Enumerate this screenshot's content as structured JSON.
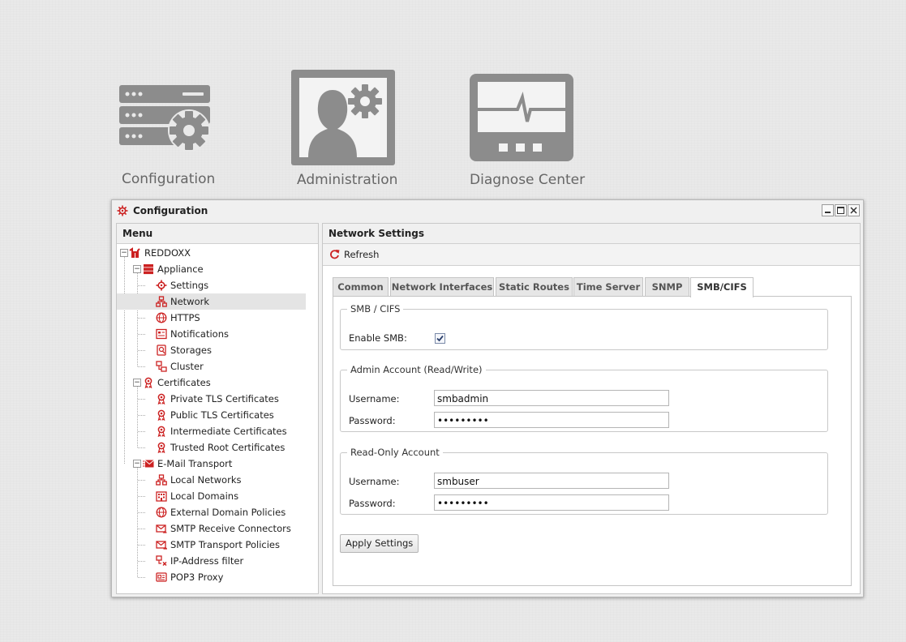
{
  "desktop": {
    "icons": [
      {
        "label": "Configuration"
      },
      {
        "label": "Administration"
      },
      {
        "label": "Diagnose Center"
      }
    ]
  },
  "window": {
    "title": "Configuration"
  },
  "menu": {
    "header": "Menu",
    "tree": [
      {
        "label": "REDDOXX",
        "icon": "reddoxx-logo-icon"
      },
      {
        "label": "Appliance",
        "icon": "appliance-icon"
      },
      {
        "label": "Settings",
        "icon": "gear-icon"
      },
      {
        "label": "Network",
        "icon": "network-icon",
        "selected": true
      },
      {
        "label": "HTTPS",
        "icon": "globe-icon"
      },
      {
        "label": "Notifications",
        "icon": "notification-icon"
      },
      {
        "label": "Storages",
        "icon": "storage-icon"
      },
      {
        "label": "Cluster",
        "icon": "cluster-icon"
      },
      {
        "label": "Certificates",
        "icon": "certificate-icon"
      },
      {
        "label": "Private TLS Certificates",
        "icon": "certificate-icon"
      },
      {
        "label": "Public TLS Certificates",
        "icon": "certificate-icon"
      },
      {
        "label": "Intermediate Certificates",
        "icon": "certificate-icon"
      },
      {
        "label": "Trusted Root Certificates",
        "icon": "certificate-icon"
      },
      {
        "label": "E-Mail Transport",
        "icon": "email-transport-icon"
      },
      {
        "label": "Local Networks",
        "icon": "network-icon"
      },
      {
        "label": "Local Domains",
        "icon": "building-icon"
      },
      {
        "label": "External Domain Policies",
        "icon": "globe-icon"
      },
      {
        "label": "SMTP Receive Connectors",
        "icon": "mail-receive-icon"
      },
      {
        "label": "SMTP Transport Policies",
        "icon": "mail-send-icon"
      },
      {
        "label": "IP-Address filter",
        "icon": "ip-filter-icon"
      },
      {
        "label": "POP3 Proxy",
        "icon": "pop3-icon"
      }
    ]
  },
  "settings": {
    "header": "Network Settings",
    "refresh_label": "Refresh",
    "tabs": [
      {
        "label": "Common"
      },
      {
        "label": "Network Interfaces"
      },
      {
        "label": "Static Routes"
      },
      {
        "label": "Time Server"
      },
      {
        "label": "SNMP"
      },
      {
        "label": "SMB/CIFS",
        "active": true
      }
    ],
    "smb": {
      "legend": "SMB / CIFS",
      "enable_label": "Enable SMB:",
      "enabled": true
    },
    "admin_account": {
      "legend": "Admin Account (Read/Write)",
      "username_label": "Username:",
      "username": "smbadmin",
      "password_label": "Password:",
      "password": "•••••••••"
    },
    "readonly_account": {
      "legend": "Read-Only Account",
      "username_label": "Username:",
      "username": "smbuser",
      "password_label": "Password:",
      "password": "•••••••••"
    },
    "apply_label": "Apply Settings"
  },
  "colors": {
    "accent_red": "#cc2222",
    "icon_gray": "#8c8c8c"
  }
}
